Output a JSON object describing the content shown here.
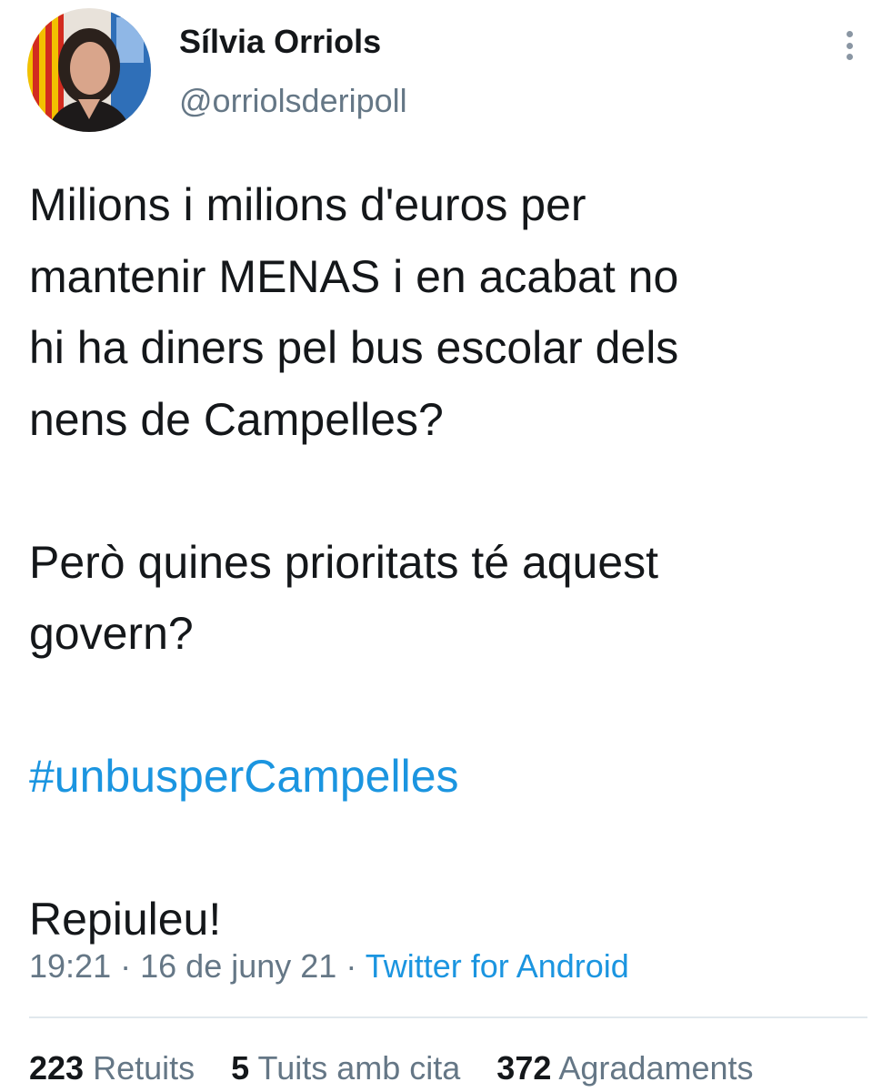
{
  "tweet": {
    "author": {
      "name": "Sílvia Orriols",
      "handle": "@orriolsderipoll"
    },
    "text": {
      "paragraph1": [
        "Milions i milions d'euros per",
        "mantenir MENAS i en acabat no",
        "hi ha diners pel bus escolar dels",
        "nens de Campelles?"
      ],
      "paragraph2": [
        "Però quines prioritats té aquest",
        "govern?"
      ],
      "hashtag": "#unbusperCampelles",
      "closing": "Repiuleu!"
    },
    "meta": {
      "time": "19:21",
      "date": "16 de juny 21",
      "separator": "·",
      "source": "Twitter for Android"
    },
    "stats": {
      "retweets_count": "223",
      "retweets_label": "Retuits",
      "quotes_count": "5",
      "quotes_label": "Tuits amb cita",
      "likes_count": "372",
      "likes_label": "Agradaments"
    }
  },
  "colors": {
    "text": "#14171a",
    "secondary": "#657786",
    "link": "#1b95e0",
    "divider": "#e1e8ed"
  },
  "icons": {
    "more": "more-vertical-icon"
  }
}
